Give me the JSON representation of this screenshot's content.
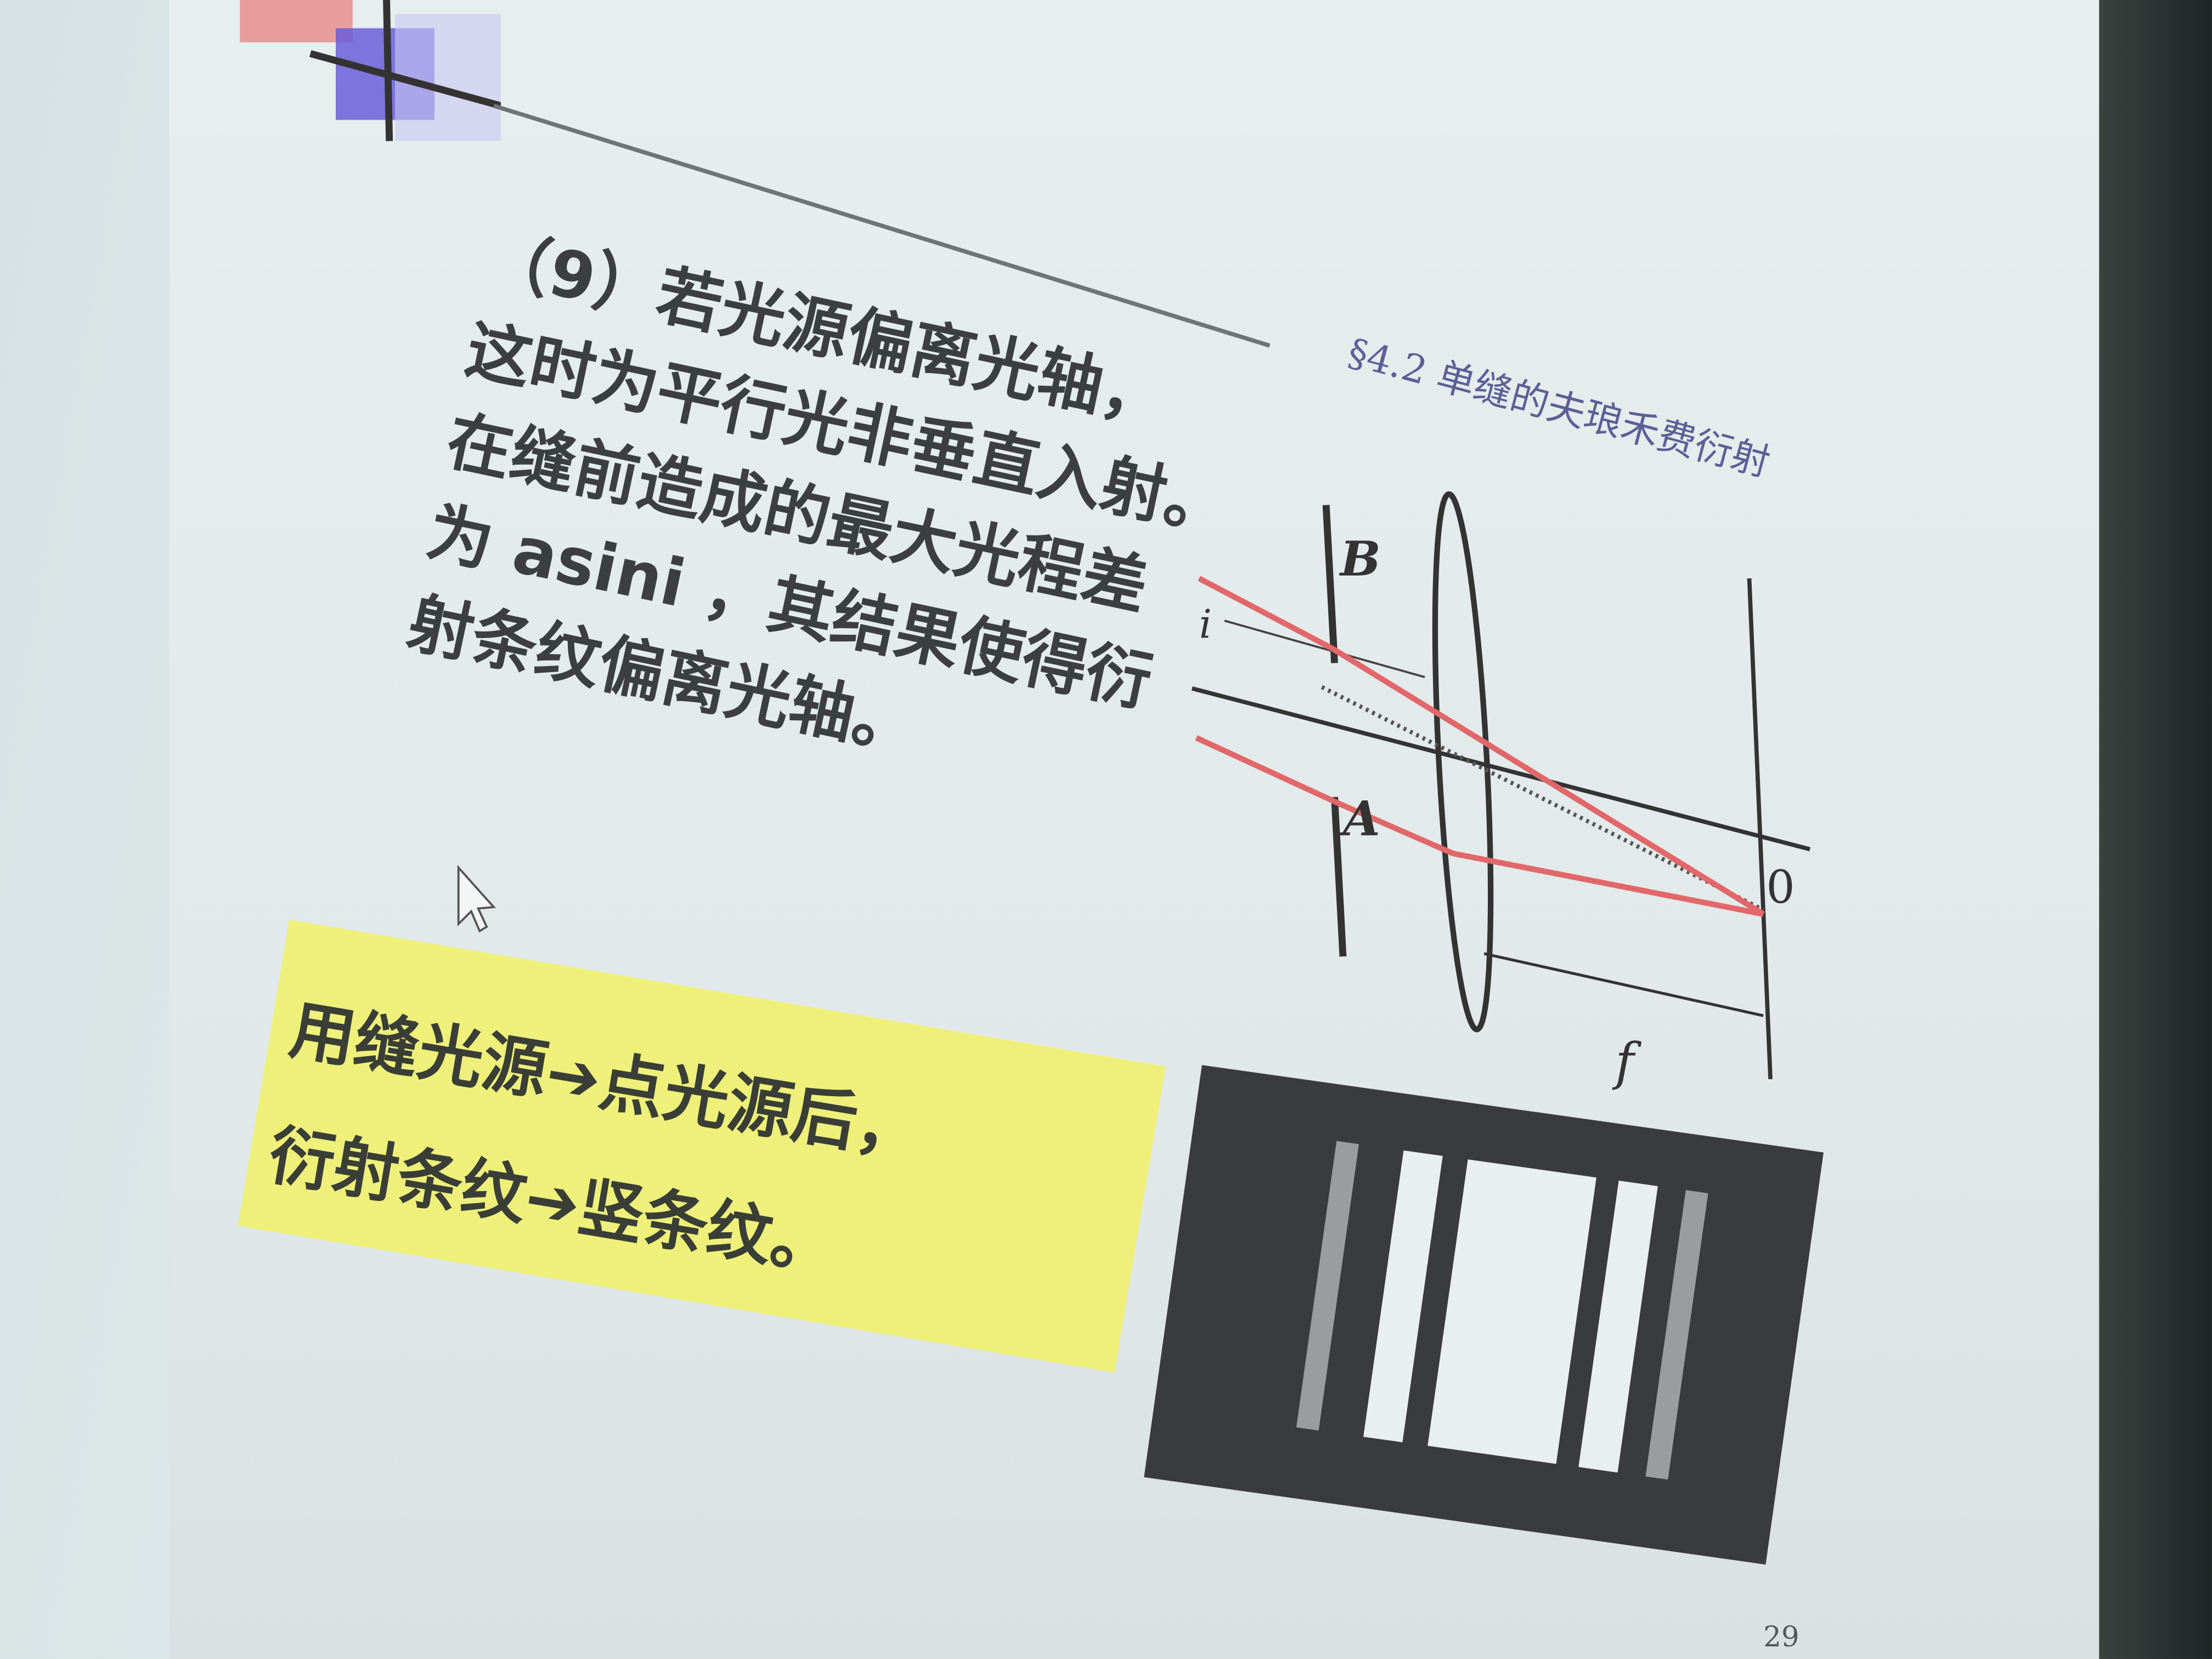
{
  "slide": {
    "section_header": "§4.2 单缝的夫琅禾费衍射",
    "body_lines": [
      "（9）若光源偏离光轴，",
      "这时为平行光非垂直入射。",
      "在缝前造成的最大光程差",
      "为 asini ，其结果使得衍",
      "射条纹偏离光轴。"
    ],
    "highlight_box": {
      "line1": "用缝光源➔点光源后，",
      "line2": "衍射条纹➔竖条纹。",
      "color": "#eef07a"
    },
    "diagram_labels": {
      "b": "B",
      "a": "A",
      "i": "i",
      "o": "0",
      "f": "f"
    },
    "ray_color": "#e2676a",
    "page_number": "29"
  }
}
